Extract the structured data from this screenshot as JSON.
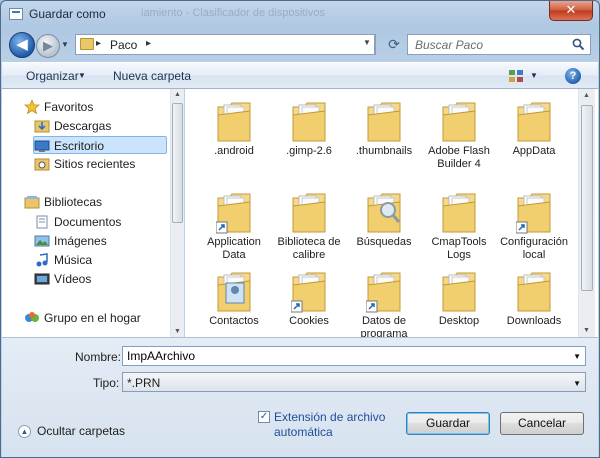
{
  "window": {
    "title": "Guardar como",
    "ghost_text": "iamiento - Clasificador de dispositivos",
    "close_glyph": "✕"
  },
  "address": {
    "path": "Paco",
    "separator": "▸",
    "search_placeholder": "Buscar Paco"
  },
  "toolbar": {
    "organize_label": "Organizar",
    "new_folder_label": "Nueva carpeta",
    "help_glyph": "?"
  },
  "navpane": {
    "favorites_header": "Favoritos",
    "favorites": [
      {
        "label": "Descargas",
        "icon": "downloads-icon"
      },
      {
        "label": "Escritorio",
        "icon": "desktop-icon",
        "selected": true
      },
      {
        "label": "Sitios recientes",
        "icon": "recent-places-icon"
      }
    ],
    "libraries_header": "Bibliotecas",
    "libraries": [
      {
        "label": "Documentos",
        "icon": "documents-icon"
      },
      {
        "label": "Imágenes",
        "icon": "pictures-icon"
      },
      {
        "label": "Música",
        "icon": "music-icon"
      },
      {
        "label": "Vídeos",
        "icon": "videos-icon"
      }
    ],
    "homegroup": "Grupo en el hogar"
  },
  "files": [
    {
      "label": ".android",
      "icon": "folder-icon"
    },
    {
      "label": ".gimp-2.6",
      "icon": "folder-icon"
    },
    {
      "label": ".thumbnails",
      "icon": "folder-icon"
    },
    {
      "label": "Adobe Flash Builder 4",
      "icon": "folder-icon"
    },
    {
      "label": "AppData",
      "icon": "folder-icon"
    },
    {
      "label": "Application Data",
      "icon": "folder-shortcut-icon"
    },
    {
      "label": "Biblioteca de calibre",
      "icon": "folder-icon"
    },
    {
      "label": "Búsquedas",
      "icon": "searches-folder-icon"
    },
    {
      "label": "CmapTools Logs",
      "icon": "folder-icon"
    },
    {
      "label": "Configuración local",
      "icon": "folder-shortcut-icon"
    },
    {
      "label": "Contactos",
      "icon": "contacts-folder-icon"
    },
    {
      "label": "Cookies",
      "icon": "folder-shortcut-icon"
    },
    {
      "label": "Datos de programa",
      "icon": "folder-shortcut-icon"
    },
    {
      "label": "Desktop",
      "icon": "folder-icon"
    },
    {
      "label": "Downloads",
      "icon": "folder-icon"
    }
  ],
  "form": {
    "name_label": "Nombre:",
    "name_value": "ImpAArchivo",
    "type_label": "Tipo:",
    "type_value": "*.PRN",
    "hide_folders_label": "Ocultar carpetas",
    "auto_ext_line1": "Extensión de archivo",
    "auto_ext_line2": "automática",
    "auto_ext_checked": true,
    "save_label": "Guardar",
    "cancel_label": "Cancelar"
  }
}
